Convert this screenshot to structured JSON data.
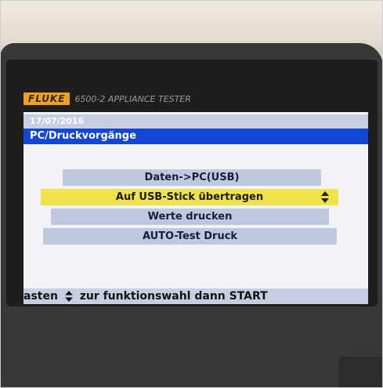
{
  "device": {
    "brand": "FLUKE",
    "model": "6500-2 APPLIANCE TESTER"
  },
  "screen": {
    "date": "17/07/2016",
    "title": "PC/Druckvorgänge",
    "menu": [
      {
        "label": "Daten->PC(USB)",
        "selected": false
      },
      {
        "label": "Auf USB-Stick übertragen",
        "selected": true
      },
      {
        "label": "Werte drucken",
        "selected": false
      },
      {
        "label": "AUTO-Test Druck",
        "selected": false
      }
    ],
    "status": {
      "prefix": "asten",
      "icon": "updown-arrows-icon",
      "suffix": "zur funktionswahl dann START"
    }
  },
  "colors": {
    "title_bar": "#1446d6",
    "selected_item": "#f0e24a",
    "menu_item": "#bfc8df",
    "brand_badge": "#f0a020"
  }
}
